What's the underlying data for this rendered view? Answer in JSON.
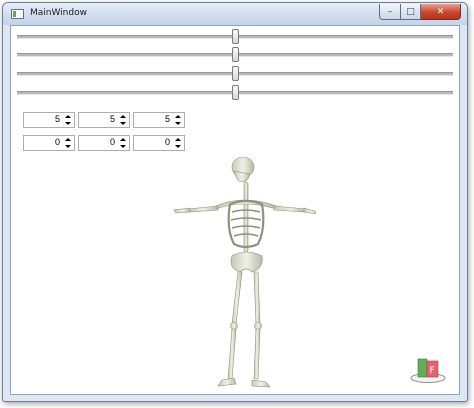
{
  "window": {
    "title": "MainWindow",
    "minimize_glyph": "–",
    "maximize_glyph": "□",
    "close_glyph": "✕"
  },
  "sliders": [
    {
      "name": "slider-1",
      "value": 0.5
    },
    {
      "name": "slider-2",
      "value": 0.5
    },
    {
      "name": "slider-3",
      "value": 0.5
    },
    {
      "name": "slider-4",
      "value": 0.5
    }
  ],
  "spinners": {
    "row1": [
      "5",
      "5",
      "5"
    ],
    "row2": [
      "0",
      "0",
      "0"
    ]
  },
  "viewport": {
    "model": "skeleton",
    "gizmo_icon": "axis-gizmo-icon",
    "colors": {
      "bone": "#d9dccb",
      "gizmo_red": "#e8626a",
      "gizmo_green": "#5fae5a"
    }
  }
}
